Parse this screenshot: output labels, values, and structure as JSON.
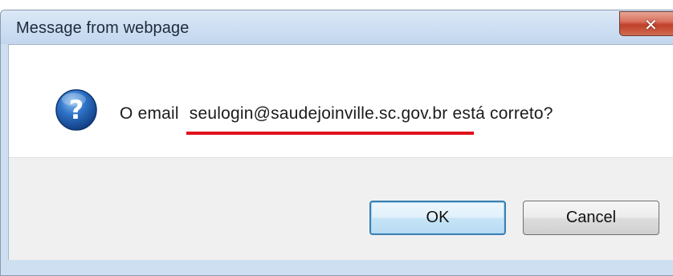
{
  "window": {
    "title": "Message from webpage",
    "close_glyph": "✕"
  },
  "icon": {
    "name": "question-icon",
    "glyph": "?",
    "color": "#1f5fb0"
  },
  "message": {
    "prefix": "O email",
    "email": "seulogin@saudejoinville.sc.gov.br",
    "suffix": "está correto?",
    "underline_color": "#e0121b"
  },
  "buttons": {
    "ok_label": "OK",
    "cancel_label": "Cancel"
  }
}
